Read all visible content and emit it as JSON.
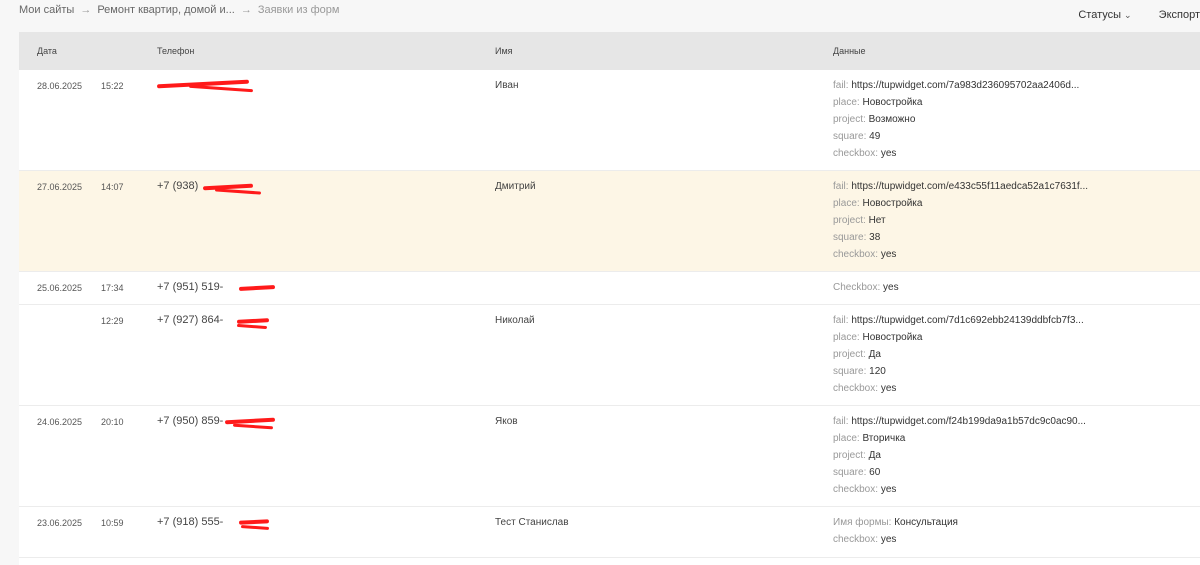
{
  "breadcrumb": {
    "item1": "Мои сайты",
    "item2": "Ремонт квартир, домой и...",
    "item3": "Заявки из форм",
    "arrow": "→"
  },
  "actions": {
    "statuses": "Статусы",
    "export": "Экспорт"
  },
  "table": {
    "headers": {
      "date": "Дата",
      "phone": "Телефон",
      "name": "Имя",
      "data": "Данные"
    },
    "rows": [
      {
        "date": "28.06.2025",
        "time": "15:22",
        "phone": "",
        "name": "Иван",
        "data": [
          {
            "k": "fail:",
            "v": "https://tupwidget.com/7a983d236095702aa2406d..."
          },
          {
            "k": "place:",
            "v": "Новостройка"
          },
          {
            "k": "project:",
            "v": "Возможно"
          },
          {
            "k": "square:",
            "v": "49"
          },
          {
            "k": "checkbox:",
            "v": "yes"
          }
        ]
      },
      {
        "date": "27.06.2025",
        "time": "14:07",
        "phone": "+7 (938)",
        "name": "Дмитрий",
        "data": [
          {
            "k": "fail:",
            "v": "https://tupwidget.com/e433c55f11aedca52a1c7631f..."
          },
          {
            "k": "place:",
            "v": "Новостройка"
          },
          {
            "k": "project:",
            "v": "Нет"
          },
          {
            "k": "square:",
            "v": "38"
          },
          {
            "k": "checkbox:",
            "v": "yes"
          }
        ]
      },
      {
        "date": "25.06.2025",
        "time": "17:34",
        "phone": "+7 (951) 519-",
        "name": "",
        "data": [
          {
            "k": "Checkbox:",
            "v": "yes"
          }
        ]
      },
      {
        "date": "",
        "time": "12:29",
        "phone": "+7 (927) 864-",
        "name": "Николай",
        "data": [
          {
            "k": "fail:",
            "v": "https://tupwidget.com/7d1c692ebb24139ddbfcb7f3..."
          },
          {
            "k": "place:",
            "v": "Новостройка"
          },
          {
            "k": "project:",
            "v": "Да"
          },
          {
            "k": "square:",
            "v": "120"
          },
          {
            "k": "checkbox:",
            "v": "yes"
          }
        ]
      },
      {
        "date": "24.06.2025",
        "time": "20:10",
        "phone": "+7 (950) 859-",
        "name": "Яков",
        "data": [
          {
            "k": "fail:",
            "v": "https://tupwidget.com/f24b199da9a1b57dc9c0ac90..."
          },
          {
            "k": "place:",
            "v": "Вторичка"
          },
          {
            "k": "project:",
            "v": "Да"
          },
          {
            "k": "square:",
            "v": "60"
          },
          {
            "k": "checkbox:",
            "v": "yes"
          }
        ]
      },
      {
        "date": "23.06.2025",
        "time": "10:59",
        "phone": "+7 (918) 555-",
        "name": "Тест Станислав",
        "data": [
          {
            "k": "Имя формы:",
            "v": "Консультация"
          },
          {
            "k": "checkbox:",
            "v": "yes"
          }
        ]
      }
    ]
  }
}
